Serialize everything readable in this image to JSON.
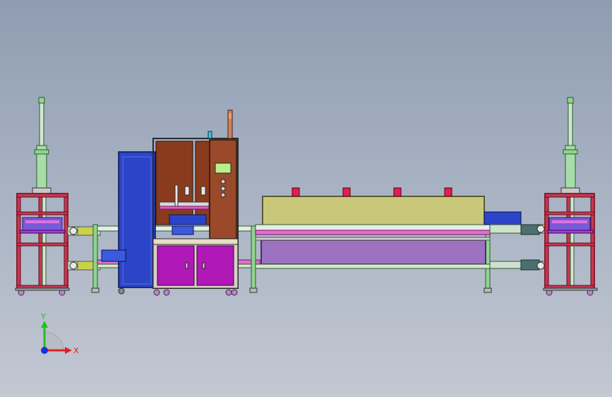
{
  "viewport": {
    "background_top": "#8f9db2",
    "background_bottom": "#c3c8d2"
  },
  "colors": {
    "frame_red": "#b0223a",
    "frame_green": "#8fd48f",
    "frame_light": "#d8e6d0",
    "blue_cabinet": "#2b44c8",
    "brown_panel": "#8a3b1e",
    "magenta_door": "#b018b8",
    "oven_top": "#c9c779",
    "oven_bottom": "#9c72c0",
    "conveyor_pink": "#e060c0",
    "screen_green": "#b8f08a",
    "indicator_red": "#e02050"
  },
  "triad": {
    "y_label": "Y",
    "x_label": "X",
    "x_color": "#e02020",
    "y_color": "#20c020",
    "origin_color": "#1a30e0"
  },
  "assemblies": [
    {
      "name": "left-elevator-tower"
    },
    {
      "name": "blue-electrical-cabinet"
    },
    {
      "name": "dispensing-station"
    },
    {
      "name": "curing-oven"
    },
    {
      "name": "right-elevator-tower"
    }
  ]
}
